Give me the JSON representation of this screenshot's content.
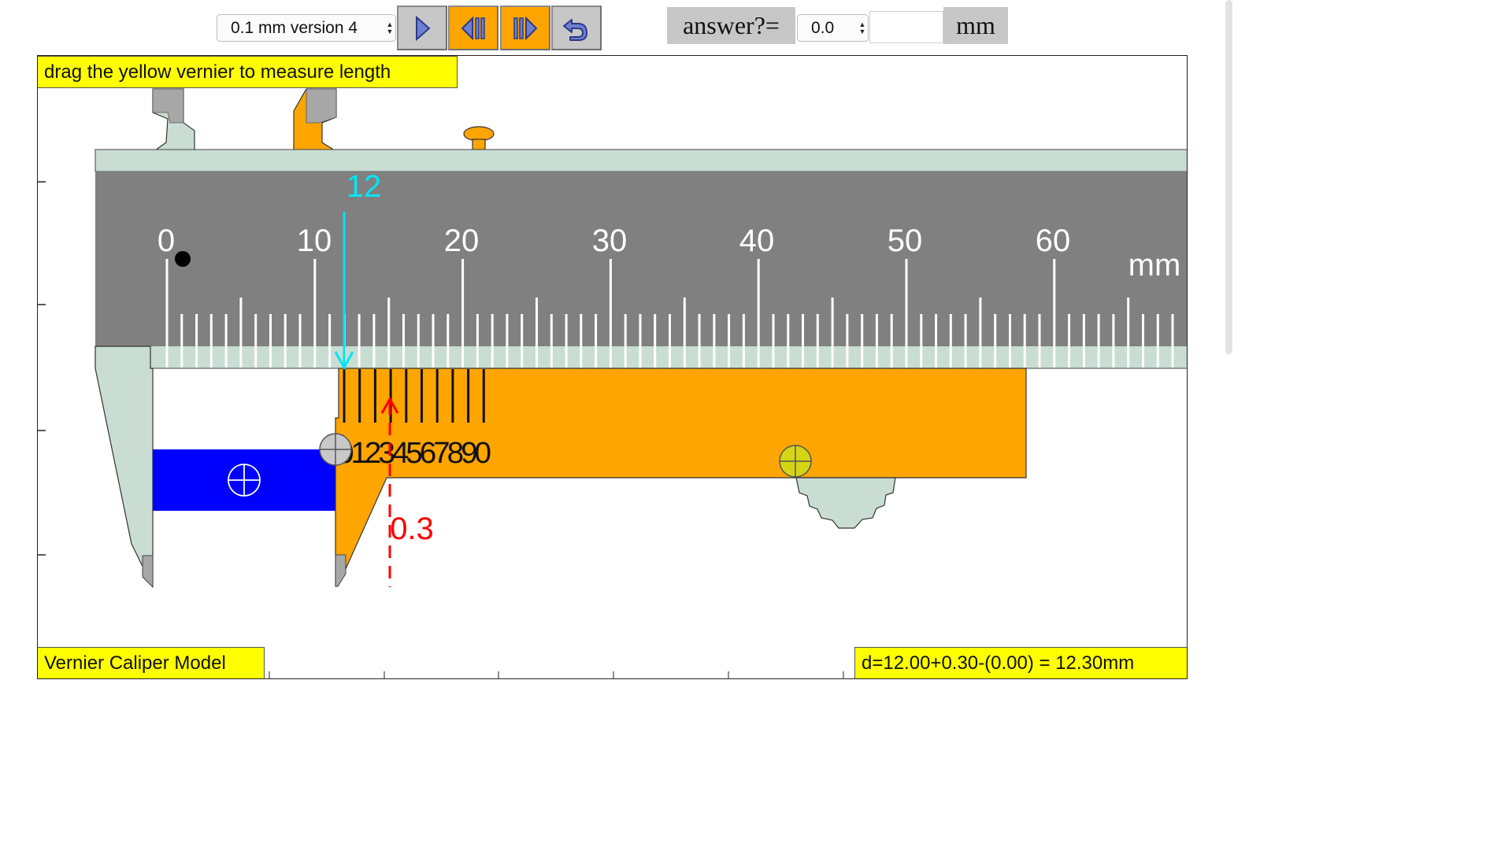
{
  "toolbar": {
    "version_select": "0.1 mm version 4",
    "buttons": [
      {
        "name": "play-button",
        "icon": "play-icon",
        "color": "#c7c7c7"
      },
      {
        "name": "step-back-button",
        "icon": "step-back-icon",
        "color": "#ffa500"
      },
      {
        "name": "step-forward-button",
        "icon": "step-forward-icon",
        "color": "#ffa500"
      },
      {
        "name": "reset-button",
        "icon": "undo-icon",
        "color": "#c7c7c7"
      }
    ],
    "answer_label": "answer?=",
    "answer_select": "0.0",
    "answer_value": "",
    "unit_label": "mm"
  },
  "instruction": "drag the yellow vernier to measure length",
  "model_title": "Vernier Caliper Model",
  "result_formula": "d=12.00+0.30-(0.00) = 12.30mm",
  "main_scale": {
    "labels": [
      "0",
      "10",
      "20",
      "30",
      "40",
      "50",
      "60"
    ],
    "unit": "mm",
    "color": "#808080"
  },
  "vernier": {
    "digits": "01234567890",
    "color": "#ffa500"
  },
  "readings": {
    "main": "12",
    "vernier": "0.3",
    "main_color": "#00e5f5",
    "vernier_color": "#ff0000"
  },
  "object_color": "#0000ff",
  "jaw_color": "#c9ddd3"
}
